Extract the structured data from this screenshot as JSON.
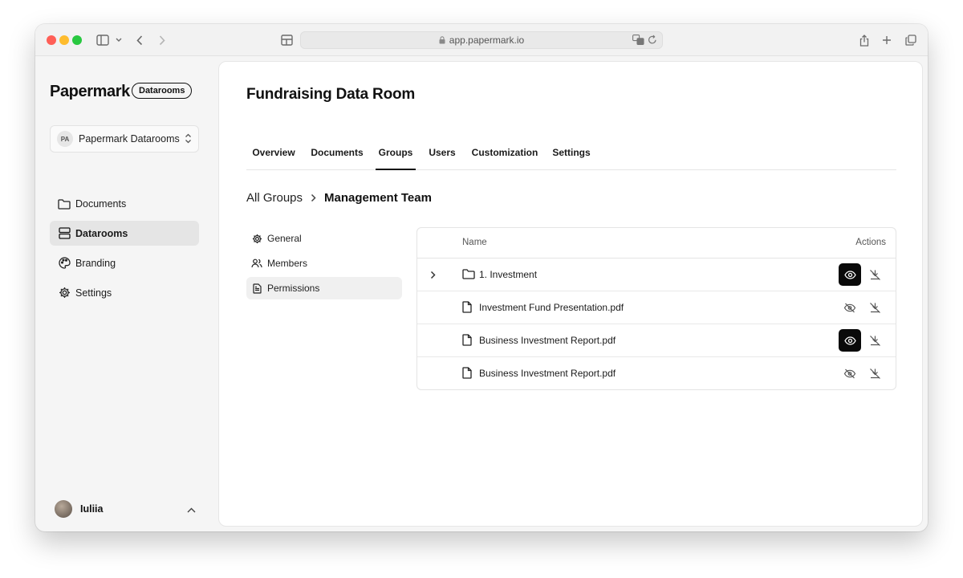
{
  "browser": {
    "url": "app.papermark.io"
  },
  "sidebar": {
    "brand": "Papermark",
    "brand_badge": "Datarooms",
    "team": {
      "initials": "PA",
      "name": "Papermark Datarooms"
    },
    "items": [
      {
        "label": "Documents",
        "icon": "folder-icon",
        "active": false
      },
      {
        "label": "Datarooms",
        "icon": "server-icon",
        "active": true
      },
      {
        "label": "Branding",
        "icon": "palette-icon",
        "active": false
      },
      {
        "label": "Settings",
        "icon": "gear-icon",
        "active": false
      }
    ],
    "user": {
      "name": "Iuliia"
    }
  },
  "main": {
    "title": "Fundraising Data Room",
    "tabs": [
      {
        "label": "Overview",
        "active": false
      },
      {
        "label": "Documents",
        "active": false
      },
      {
        "label": "Groups",
        "active": true
      },
      {
        "label": "Users",
        "active": false
      },
      {
        "label": "Customization",
        "active": false
      },
      {
        "label": "Settings",
        "active": false
      }
    ],
    "breadcrumb": {
      "parent": "All Groups",
      "current": "Management Team"
    },
    "subnav": [
      {
        "label": "General",
        "icon": "gear-icon",
        "active": false
      },
      {
        "label": "Members",
        "icon": "users-icon",
        "active": false
      },
      {
        "label": "Permissions",
        "icon": "file-icon",
        "active": true
      }
    ],
    "table": {
      "columns": {
        "name": "Name",
        "actions": "Actions"
      },
      "rows": [
        {
          "type": "folder",
          "name": "1. Investment",
          "expandable": true,
          "view_enabled": true,
          "download_enabled": false
        },
        {
          "type": "file",
          "name": "Investment Fund Presentation.pdf",
          "expandable": false,
          "view_enabled": false,
          "download_enabled": false
        },
        {
          "type": "file",
          "name": "Business Investment Report.pdf",
          "expandable": false,
          "view_enabled": true,
          "download_enabled": false
        },
        {
          "type": "file",
          "name": "Business Investment Report.pdf",
          "expandable": false,
          "view_enabled": false,
          "download_enabled": false
        }
      ]
    }
  }
}
